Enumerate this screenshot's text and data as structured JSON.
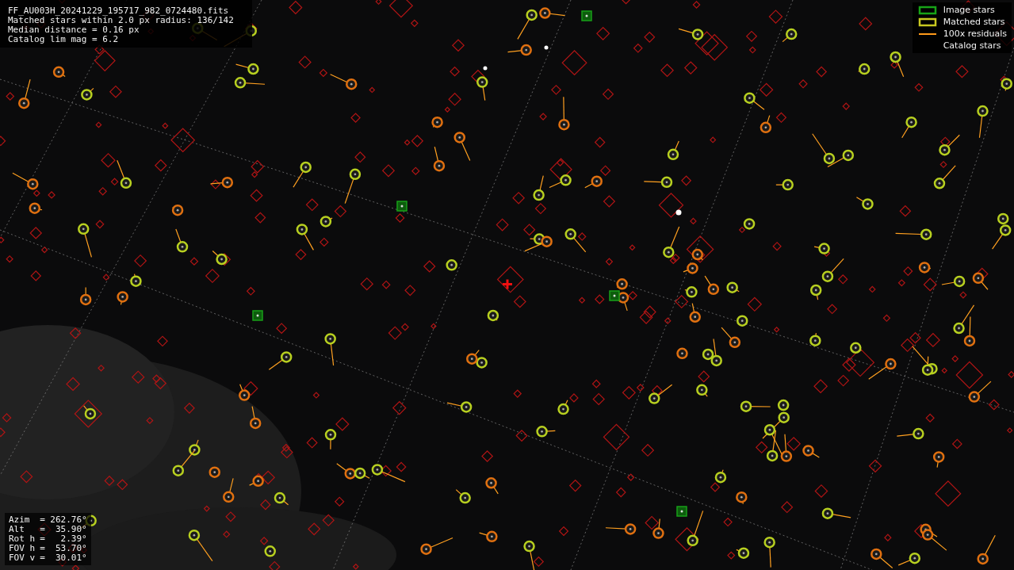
{
  "info": {
    "lines": [
      "FF_AU003H_20241229_195717_982_0724480.fits",
      "Matched stars within 2.0 px radius: 136/142",
      "Median distance = 0.16 px",
      "Catalog lim mag = 6.2"
    ]
  },
  "legend": [
    {
      "kind": "image",
      "label": "Image stars",
      "color": "#17a317"
    },
    {
      "kind": "matched",
      "label": "Matched stars",
      "color": "#c8c820"
    },
    {
      "kind": "residual",
      "label": "100x residuals",
      "color": "#ff9a1a"
    },
    {
      "kind": "catalog",
      "label": "Catalog stars"
    }
  ],
  "pointing": [
    {
      "label": "Azim",
      "value": "= 262.76°"
    },
    {
      "label": "Alt",
      "value": "=  35.90°"
    },
    {
      "label": "Rot h",
      "value": "=   2.39°"
    },
    {
      "label": "FOV h",
      "value": "=  53.70°"
    },
    {
      "label": "FOV v",
      "value": "=  30.01°"
    }
  ]
}
